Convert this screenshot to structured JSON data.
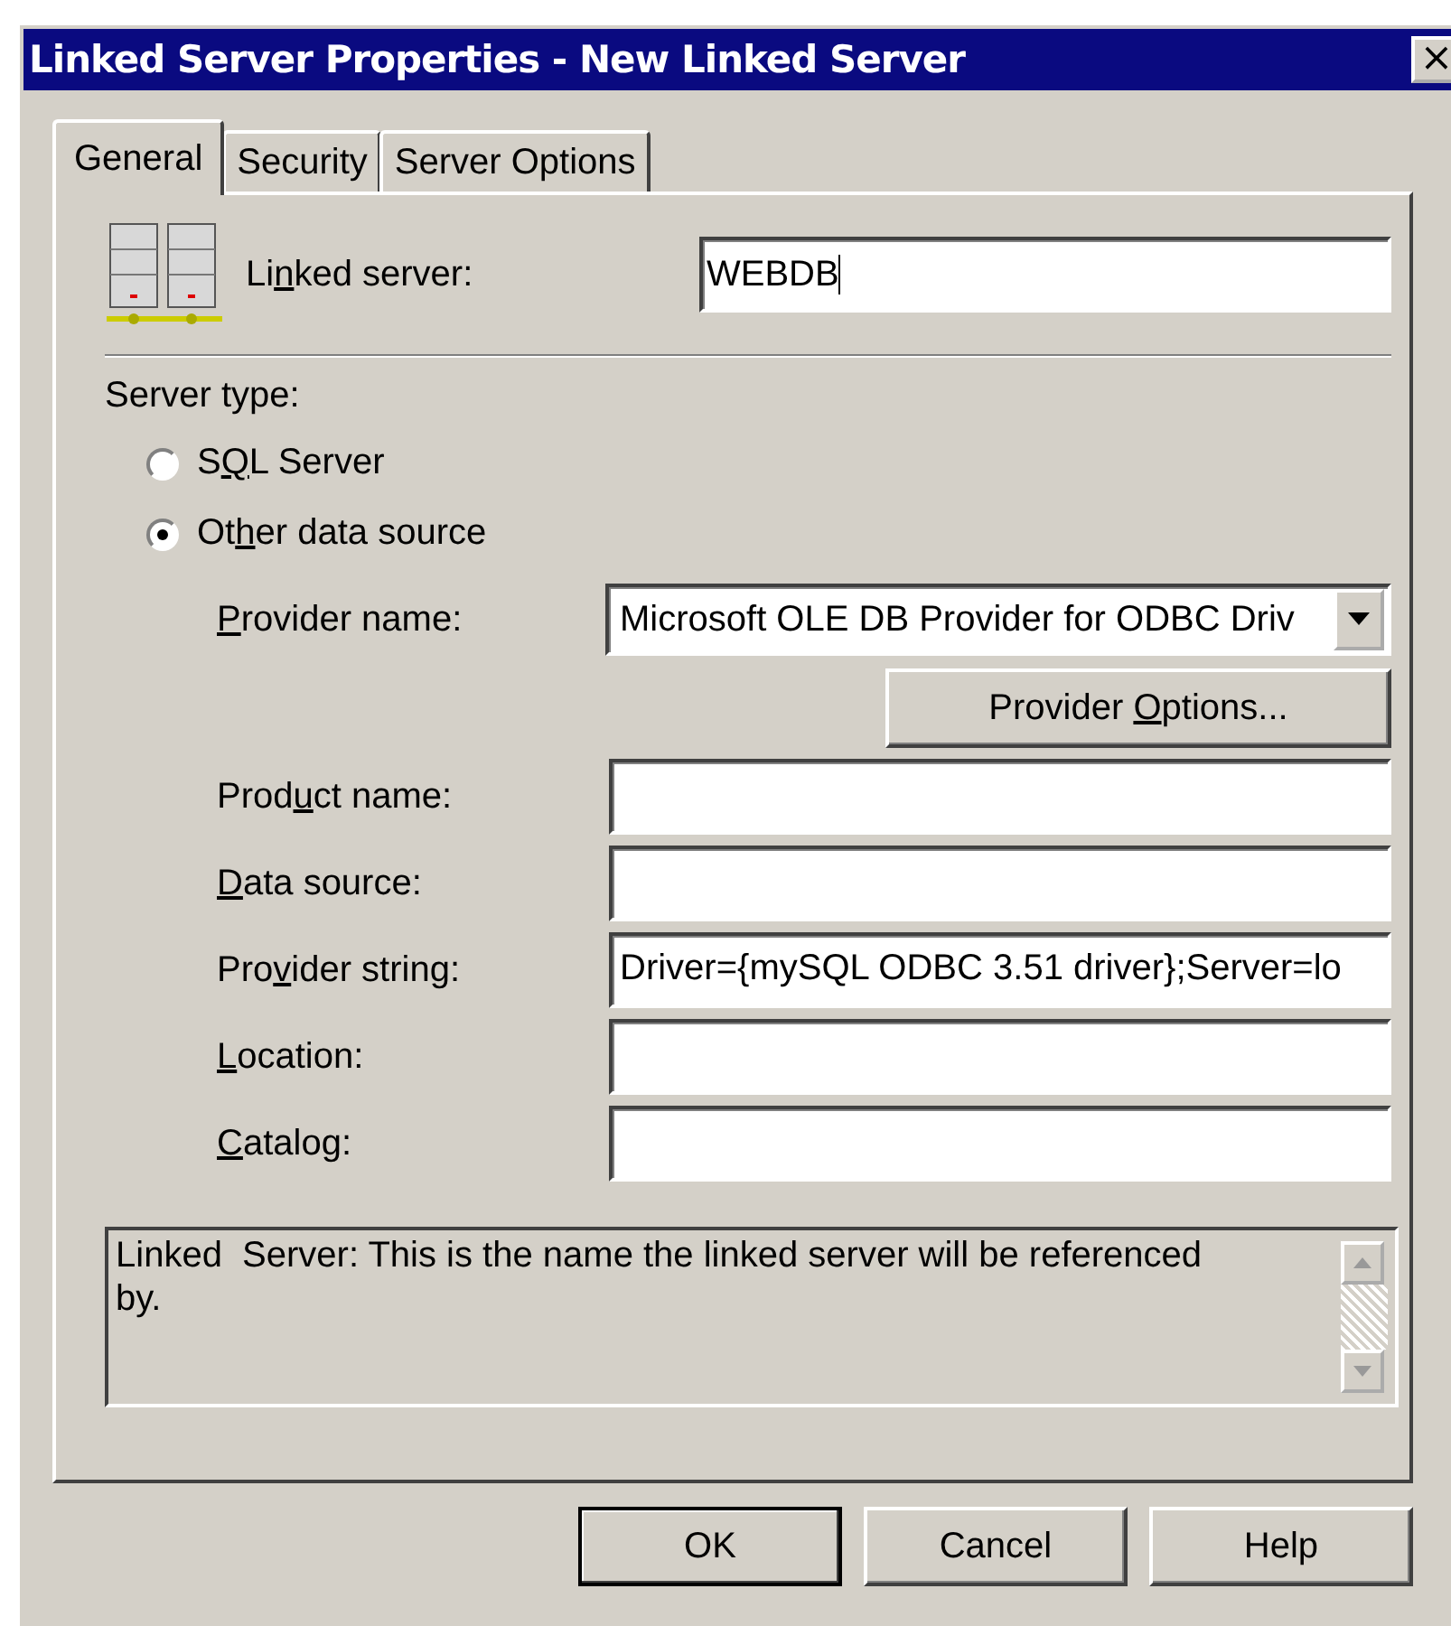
{
  "window": {
    "title": "Linked Server Properties - New Linked Server",
    "close": "×"
  },
  "tabs": [
    {
      "label": "General",
      "selected": true
    },
    {
      "label": "Security",
      "selected": false
    },
    {
      "label": "Server Options",
      "selected": false
    }
  ],
  "linked_server": {
    "label": {
      "before": "Li",
      "key": "n",
      "after": "ked server:"
    },
    "value": "WEBDB"
  },
  "server_type": {
    "label": "Server type:",
    "options": [
      {
        "label": {
          "before": "S",
          "key": "Q",
          "after": "L Server"
        },
        "selected": false
      },
      {
        "label": {
          "before": "Ot",
          "key": "h",
          "after": "er data source"
        },
        "selected": true
      }
    ]
  },
  "provider": {
    "label": {
      "key": "P",
      "after": "rovider name:"
    },
    "value": "Microsoft OLE DB Provider for ODBC Driv"
  },
  "provider_options_button": {
    "label": {
      "before": "Provider ",
      "key": "O",
      "after": "ptions..."
    }
  },
  "fields": [
    {
      "label": {
        "before": "Prod",
        "key": "u",
        "after": "ct name:"
      }
    },
    {
      "label": {
        "key": "D",
        "after": "ata source:"
      }
    },
    {
      "label": {
        "before": "Pro",
        "key": "v",
        "after": "ider string:"
      },
      "value": "Driver={mySQL ODBC 3.51 driver};Server=lo"
    },
    {
      "label": {
        "key": "L",
        "after": "ocation:"
      }
    },
    {
      "label": {
        "key": "C",
        "after": "atalog:"
      }
    }
  ],
  "description": "Linked  Server: This is the name the linked server will be referenced by.",
  "buttons": [
    "OK",
    "Cancel",
    "Help"
  ]
}
